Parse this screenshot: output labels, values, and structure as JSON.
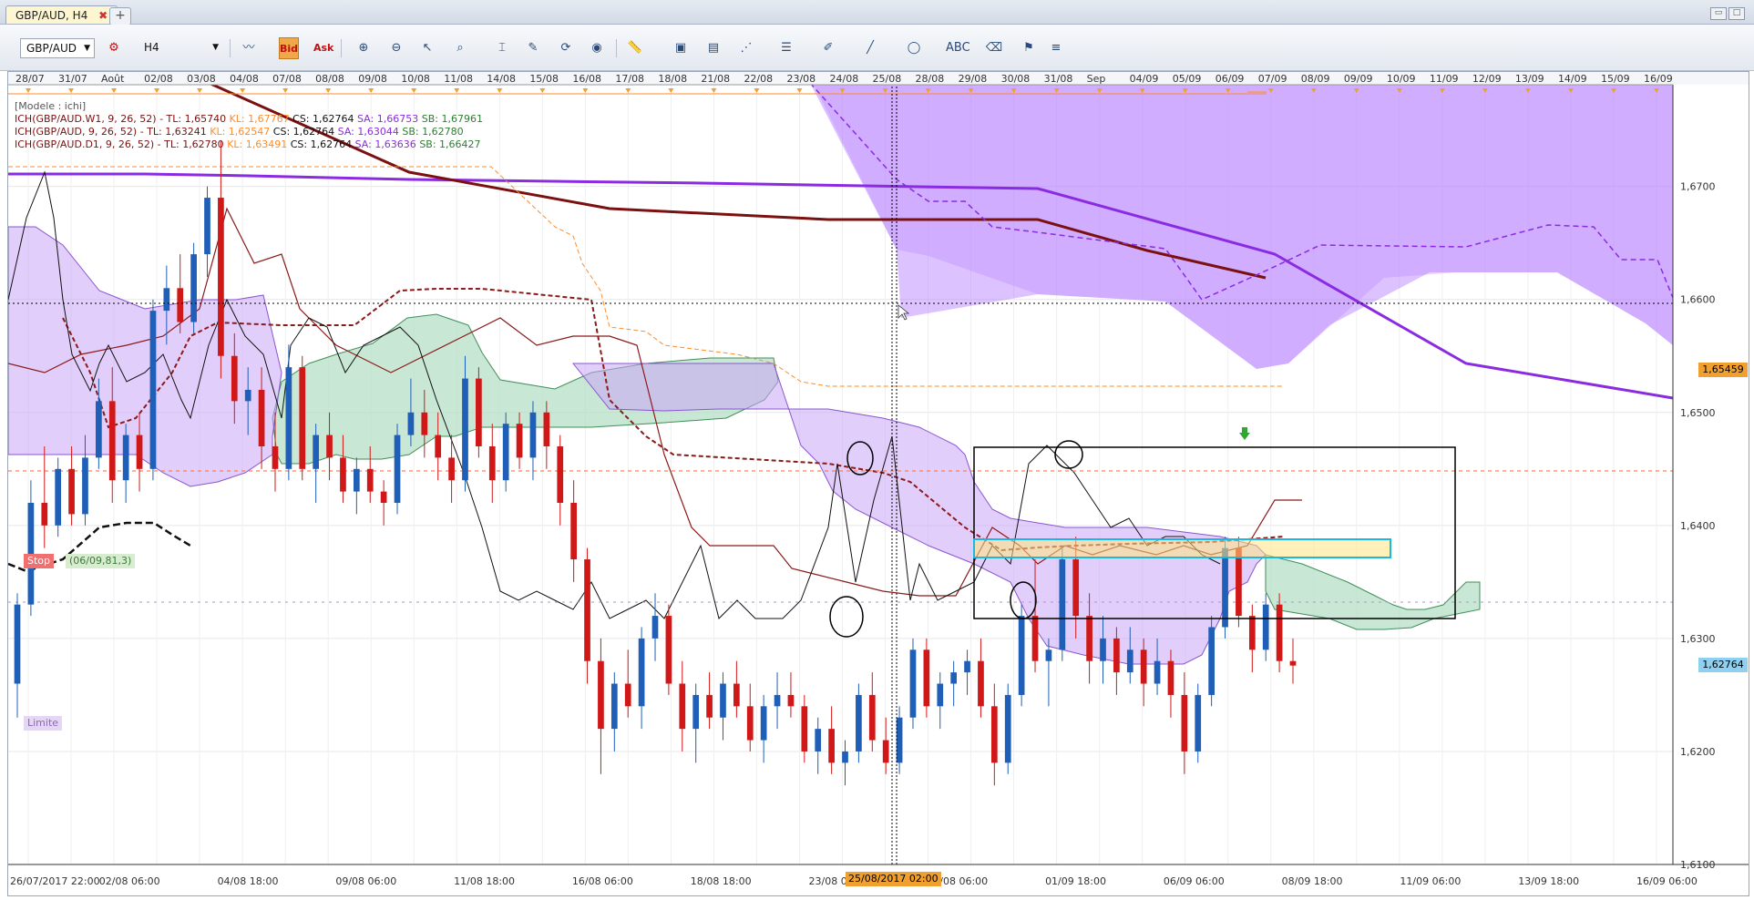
{
  "tab": {
    "title": "GBP/AUD, H4",
    "close": "✖",
    "new": "+"
  },
  "toolbar": {
    "symbol": "GBP/AUD",
    "timeframe": "H4",
    "bid_label": "Bid",
    "ask_label": "Ask"
  },
  "legend": {
    "model": "[Modele : ichi]",
    "rows": [
      {
        "name": "ICH(GBP/AUD.W1, 9, 26, 52) -",
        "tl": "TL: 1,65740",
        "kl": "KL: 1,67767",
        "cs": "CS: 1,62764",
        "sa": "SA: 1,66753",
        "sb": "SB: 1,67961"
      },
      {
        "name": "ICH(GBP/AUD, 9, 26, 52) -",
        "tl": "TL: 1,63241",
        "kl": "KL: 1,62547",
        "cs": "CS: 1,62764",
        "sa": "SA: 1,63044",
        "sb": "SB: 1,62780"
      },
      {
        "name": "ICH(GBP/AUD.D1, 9, 26, 52) -",
        "tl": "TL: 1,62780",
        "kl": "KL: 1,63491",
        "cs": "CS: 1,62764",
        "sa": "SA: 1,63636",
        "sb": "SB: 1,66427"
      }
    ]
  },
  "orders": {
    "stop_label": "Stop",
    "stop_info": "(06/09,81,3)",
    "limit_label": "Limite"
  },
  "price_tags": {
    "crosshair": "1,65459",
    "current": "1,62764"
  },
  "crosshair_time": "25/08/2017 02:00",
  "colors": {
    "bull": "#1f5fb8",
    "bear": "#d01818",
    "w1_line": "#8a2be2",
    "w1_kijun": "#7a1010",
    "h4_tenkan": "#8b1a1a",
    "orange": "#ff8c2a",
    "chikou": "#111111"
  },
  "chart_data": {
    "type": "candlestick",
    "title": "GBP/AUD, H4",
    "ylim": [
      1.61,
      1.679
    ],
    "y_ticks": [
      "1,6700",
      "1,6600",
      "1,6500",
      "1,6400",
      "1,6300",
      "1,6200",
      "1,6100"
    ],
    "x_top_labels": [
      "28/07",
      "31/07",
      "Août",
      "02/08",
      "03/08",
      "04/08",
      "07/08",
      "08/08",
      "09/08",
      "10/08",
      "11/08",
      "14/08",
      "15/08",
      "16/08",
      "17/08",
      "18/08",
      "21/08",
      "22/08",
      "23/08",
      "24/08",
      "25/08",
      "28/08",
      "29/08",
      "30/08",
      "31/08",
      "Sep",
      "04/09",
      "05/09",
      "06/09",
      "07/09",
      "08/09",
      "09/09",
      "10/09",
      "11/09",
      "12/09",
      "13/09",
      "14/09",
      "15/09",
      "16/09"
    ],
    "x_bottom_labels": [
      "26/07/2017 22:00",
      "02/08 06:00",
      "04/08 18:00",
      "09/08 06:00",
      "11/08 18:00",
      "16/08 06:00",
      "18/08 18:00",
      "23/08 06:00",
      "30/08 06:00",
      "01/09 18:00",
      "06/09 06:00",
      "08/09 18:00",
      "11/09 06:00",
      "13/09 18:00",
      "16/09 06:00"
    ],
    "candles": [
      [
        1.626,
        1.634,
        1.623,
        1.633
      ],
      [
        1.633,
        1.644,
        1.632,
        1.642
      ],
      [
        1.642,
        1.647,
        1.638,
        1.64
      ],
      [
        1.64,
        1.646,
        1.639,
        1.645
      ],
      [
        1.645,
        1.647,
        1.64,
        1.641
      ],
      [
        1.641,
        1.648,
        1.64,
        1.646
      ],
      [
        1.646,
        1.653,
        1.645,
        1.651
      ],
      [
        1.651,
        1.654,
        1.642,
        1.644
      ],
      [
        1.644,
        1.649,
        1.642,
        1.648
      ],
      [
        1.648,
        1.65,
        1.643,
        1.645
      ],
      [
        1.645,
        1.66,
        1.644,
        1.659
      ],
      [
        1.659,
        1.663,
        1.656,
        1.661
      ],
      [
        1.661,
        1.664,
        1.657,
        1.658
      ],
      [
        1.658,
        1.665,
        1.657,
        1.664
      ],
      [
        1.664,
        1.67,
        1.662,
        1.669
      ],
      [
        1.669,
        1.674,
        1.653,
        1.655
      ],
      [
        1.655,
        1.657,
        1.649,
        1.651
      ],
      [
        1.651,
        1.654,
        1.648,
        1.652
      ],
      [
        1.652,
        1.654,
        1.645,
        1.647
      ],
      [
        1.647,
        1.65,
        1.643,
        1.645
      ],
      [
        1.645,
        1.656,
        1.644,
        1.654
      ],
      [
        1.654,
        1.655,
        1.644,
        1.645
      ],
      [
        1.645,
        1.649,
        1.642,
        1.648
      ],
      [
        1.648,
        1.65,
        1.644,
        1.646
      ],
      [
        1.646,
        1.648,
        1.642,
        1.643
      ],
      [
        1.643,
        1.646,
        1.641,
        1.645
      ],
      [
        1.645,
        1.647,
        1.642,
        1.643
      ],
      [
        1.643,
        1.644,
        1.64,
        1.642
      ],
      [
        1.642,
        1.649,
        1.641,
        1.648
      ],
      [
        1.648,
        1.653,
        1.647,
        1.65
      ],
      [
        1.65,
        1.652,
        1.646,
        1.648
      ],
      [
        1.648,
        1.65,
        1.644,
        1.646
      ],
      [
        1.646,
        1.648,
        1.642,
        1.644
      ],
      [
        1.644,
        1.655,
        1.643,
        1.653
      ],
      [
        1.653,
        1.654,
        1.646,
        1.647
      ],
      [
        1.647,
        1.649,
        1.642,
        1.644
      ],
      [
        1.644,
        1.65,
        1.643,
        1.649
      ],
      [
        1.649,
        1.65,
        1.645,
        1.646
      ],
      [
        1.646,
        1.651,
        1.644,
        1.65
      ],
      [
        1.65,
        1.651,
        1.645,
        1.647
      ],
      [
        1.647,
        1.648,
        1.64,
        1.642
      ],
      [
        1.642,
        1.644,
        1.635,
        1.637
      ],
      [
        1.637,
        1.638,
        1.626,
        1.628
      ],
      [
        1.628,
        1.63,
        1.618,
        1.622
      ],
      [
        1.622,
        1.627,
        1.62,
        1.626
      ],
      [
        1.626,
        1.629,
        1.623,
        1.624
      ],
      [
        1.624,
        1.631,
        1.622,
        1.63
      ],
      [
        1.63,
        1.634,
        1.628,
        1.632
      ],
      [
        1.632,
        1.633,
        1.625,
        1.626
      ],
      [
        1.626,
        1.628,
        1.62,
        1.622
      ],
      [
        1.622,
        1.626,
        1.619,
        1.625
      ],
      [
        1.625,
        1.627,
        1.622,
        1.623
      ],
      [
        1.623,
        1.627,
        1.621,
        1.626
      ],
      [
        1.626,
        1.628,
        1.623,
        1.624
      ],
      [
        1.624,
        1.626,
        1.62,
        1.621
      ],
      [
        1.621,
        1.625,
        1.619,
        1.624
      ],
      [
        1.624,
        1.627,
        1.622,
        1.625
      ],
      [
        1.625,
        1.627,
        1.623,
        1.624
      ],
      [
        1.624,
        1.625,
        1.619,
        1.62
      ],
      [
        1.62,
        1.623,
        1.618,
        1.622
      ],
      [
        1.622,
        1.624,
        1.618,
        1.619
      ],
      [
        1.619,
        1.621,
        1.617,
        1.62
      ],
      [
        1.62,
        1.626,
        1.619,
        1.625
      ],
      [
        1.625,
        1.627,
        1.62,
        1.621
      ],
      [
        1.621,
        1.623,
        1.618,
        1.619
      ],
      [
        1.619,
        1.624,
        1.618,
        1.623
      ],
      [
        1.623,
        1.63,
        1.622,
        1.629
      ],
      [
        1.629,
        1.63,
        1.623,
        1.624
      ],
      [
        1.624,
        1.627,
        1.622,
        1.626
      ],
      [
        1.626,
        1.628,
        1.624,
        1.627
      ],
      [
        1.627,
        1.629,
        1.625,
        1.628
      ],
      [
        1.628,
        1.63,
        1.623,
        1.624
      ],
      [
        1.624,
        1.626,
        1.617,
        1.619
      ],
      [
        1.619,
        1.626,
        1.618,
        1.625
      ],
      [
        1.625,
        1.633,
        1.624,
        1.632
      ],
      [
        1.632,
        1.637,
        1.627,
        1.628
      ],
      [
        1.628,
        1.63,
        1.624,
        1.629
      ],
      [
        1.629,
        1.638,
        1.628,
        1.637
      ],
      [
        1.637,
        1.639,
        1.63,
        1.632
      ],
      [
        1.632,
        1.634,
        1.626,
        1.628
      ],
      [
        1.628,
        1.632,
        1.626,
        1.63
      ],
      [
        1.63,
        1.631,
        1.625,
        1.627
      ],
      [
        1.627,
        1.631,
        1.626,
        1.629
      ],
      [
        1.629,
        1.63,
        1.624,
        1.626
      ],
      [
        1.626,
        1.63,
        1.625,
        1.628
      ],
      [
        1.628,
        1.629,
        1.623,
        1.625
      ],
      [
        1.625,
        1.627,
        1.618,
        1.62
      ],
      [
        1.62,
        1.626,
        1.619,
        1.625
      ],
      [
        1.625,
        1.632,
        1.624,
        1.631
      ],
      [
        1.631,
        1.639,
        1.63,
        1.638
      ],
      [
        1.638,
        1.639,
        1.631,
        1.632
      ],
      [
        1.632,
        1.633,
        1.627,
        1.629
      ],
      [
        1.629,
        1.634,
        1.628,
        1.633
      ],
      [
        1.633,
        1.634,
        1.627,
        1.628
      ],
      [
        1.628,
        1.63,
        1.626,
        1.6276
      ]
    ]
  }
}
